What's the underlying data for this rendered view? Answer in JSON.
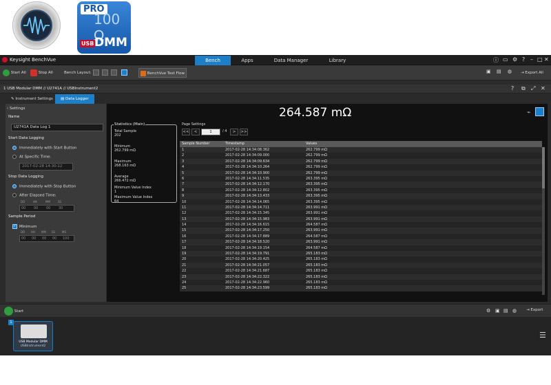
{
  "logo2": {
    "pro": "PRO",
    "ohm": "100 Ω",
    "usb": "USB",
    "dmm": "DMM"
  },
  "app": {
    "title": "Keysight BenchVue",
    "nav": [
      "Bench",
      "Apps",
      "Data Manager",
      "Library"
    ],
    "toolbar": {
      "start_all": "Start All",
      "stop_all": "Stop All",
      "bench_layout": "Bench Layout:",
      "test_flow": "BenchVue Test Flow",
      "export_all": "Export All"
    },
    "panel": {
      "title": "1  USB Modular DMM // U2741A // USBInstrument2",
      "tabs": [
        "Instrument Settings",
        "Data Logger"
      ]
    },
    "settings": {
      "label": "Settings",
      "name_label": "Name",
      "name_value": "U2741A Data Log 1",
      "start_label": "Start Data Logging",
      "start_opts": [
        "Immediately with Start Button",
        "At Specific Time:"
      ],
      "start_time": "2017-02-28 14:30:12",
      "stop_label": "Stop Data Logging",
      "stop_opts": [
        "Immediately with Stop Button",
        "After Elapsed Time:"
      ],
      "elapsed_headers": [
        "DD",
        "HH",
        "MM",
        "SS"
      ],
      "elapsed_values": [
        "00",
        "00",
        "00",
        "30"
      ],
      "period_label": "Sample Period",
      "minimum_label": "Minimum",
      "period_headers": [
        "DD",
        "HH",
        "MM",
        "SS",
        "MS"
      ],
      "period_values": [
        "00",
        "00",
        "00",
        "00",
        "100"
      ]
    },
    "reading": "264.587 mΩ",
    "stats": {
      "title": "Statistics (Main)",
      "items": [
        {
          "label": "Total Sample",
          "value": "202"
        },
        {
          "label": "Minimum",
          "value": "262.799 mΩ"
        },
        {
          "label": "Maximum",
          "value": "268.163 mΩ"
        },
        {
          "label": "Average",
          "value": "266.472 mΩ"
        },
        {
          "label": "Minimum Value Index",
          "value": "1"
        },
        {
          "label": "Maximum Value Index",
          "value": "64"
        }
      ]
    },
    "page": {
      "label": "Page Settings",
      "first": "<<",
      "prev": "<",
      "current": "1",
      "of": "/ 4",
      "next": ">",
      "last": ">>"
    },
    "table": {
      "headers": [
        "Sample Number",
        "Timestamp",
        "Values"
      ],
      "rows": [
        [
          "1",
          "2017-02-28 14:34:08.362",
          "262.799 mΩ"
        ],
        [
          "2",
          "2017-02-28 14:34:09.000",
          "262.799 mΩ"
        ],
        [
          "3",
          "2017-02-28 14:34:09.634",
          "262.799 mΩ"
        ],
        [
          "4",
          "2017-02-28 14:34:10.264",
          "262.799 mΩ"
        ],
        [
          "5",
          "2017-02-28 14:34:10.900",
          "262.799 mΩ"
        ],
        [
          "6",
          "2017-02-28 14:34:11.535",
          "263.395 mΩ"
        ],
        [
          "7",
          "2017-02-28 14:34:12.170",
          "263.395 mΩ"
        ],
        [
          "8",
          "2017-02-28 14:34:12.802",
          "263.395 mΩ"
        ],
        [
          "9",
          "2017-02-28 14:34:13.433",
          "263.395 mΩ"
        ],
        [
          "10",
          "2017-02-28 14:34:14.065",
          "263.395 mΩ"
        ],
        [
          "11",
          "2017-02-28 14:34:14.711",
          "263.991 mΩ"
        ],
        [
          "12",
          "2017-02-28 14:34:15.345",
          "263.991 mΩ"
        ],
        [
          "13",
          "2017-02-28 14:34:15.983",
          "263.991 mΩ"
        ],
        [
          "14",
          "2017-02-28 14:34:16.615",
          "264.587 mΩ"
        ],
        [
          "15",
          "2017-02-28 14:34:17.250",
          "263.991 mΩ"
        ],
        [
          "16",
          "2017-02-28 14:34:17.889",
          "264.587 mΩ"
        ],
        [
          "17",
          "2017-02-28 14:34:18.520",
          "263.991 mΩ"
        ],
        [
          "18",
          "2017-02-28 14:34:19.154",
          "264.587 mΩ"
        ],
        [
          "19",
          "2017-02-28 14:34:19.791",
          "265.183 mΩ"
        ],
        [
          "20",
          "2017-02-28 14:34:20.425",
          "265.183 mΩ"
        ],
        [
          "21",
          "2017-02-28 14:34:21.057",
          "265.183 mΩ"
        ],
        [
          "22",
          "2017-02-28 14:34:21.687",
          "265.183 mΩ"
        ],
        [
          "23",
          "2017-02-28 14:34:22.322",
          "265.183 mΩ"
        ],
        [
          "24",
          "2017-02-28 14:34:22.960",
          "265.183 mΩ"
        ],
        [
          "25",
          "2017-02-28 14:34:23.599",
          "265.183 mΩ"
        ]
      ]
    },
    "bottom": {
      "start": "Start",
      "export": "Export"
    },
    "tray": {
      "index": "1",
      "name": "USB Modular DMM",
      "sub": "USBInstrument2"
    }
  },
  "colors": {
    "accent": "#1d7fc8",
    "stop": "#d0312d",
    "start": "#2e9e3e",
    "testflow": "#e06a1a"
  }
}
